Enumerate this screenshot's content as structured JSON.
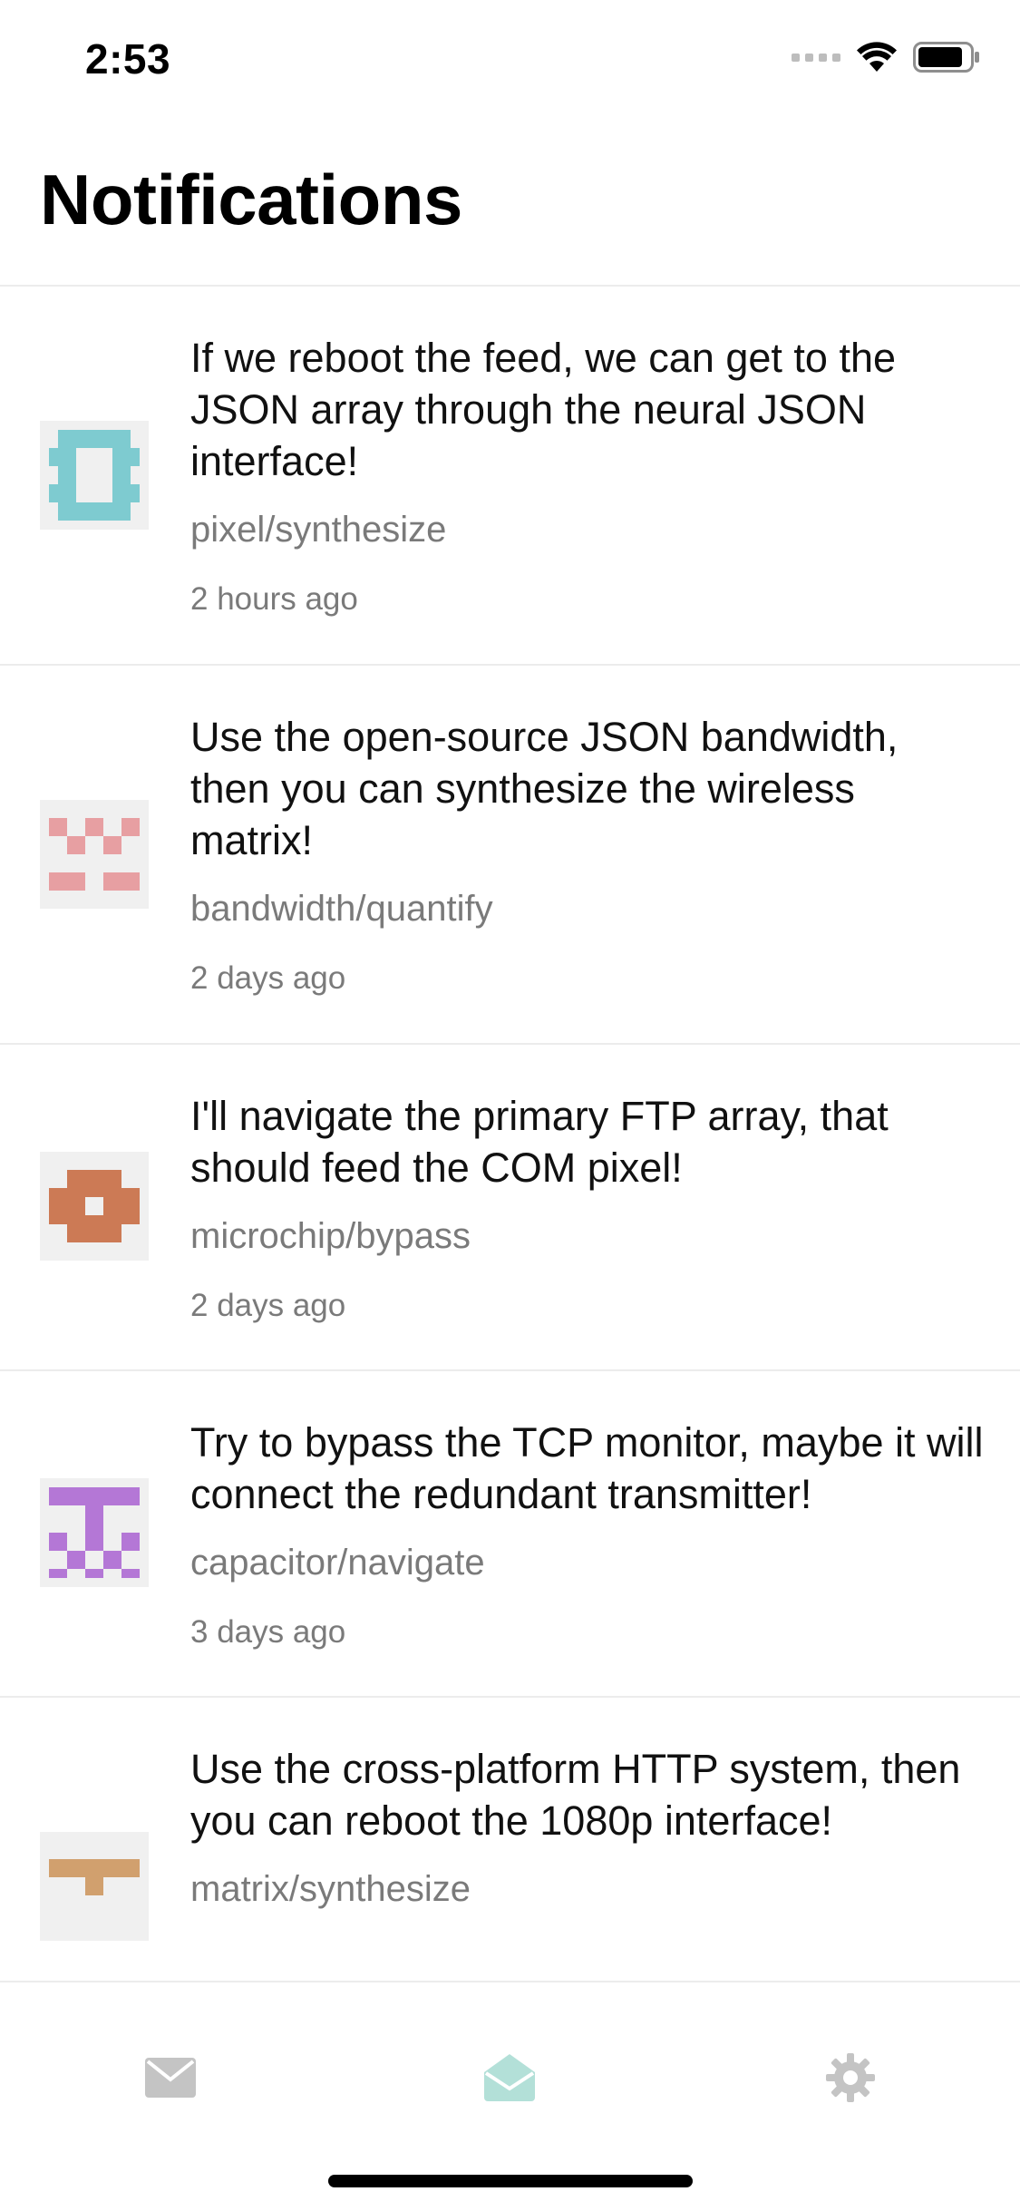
{
  "status_bar": {
    "time": "2:53"
  },
  "page": {
    "title": "Notifications"
  },
  "notifications": [
    {
      "message": "If we reboot the feed, we can get to the JSON array through the neural JSON interface!",
      "path": "pixel/synthesize",
      "time": "2 hours ago",
      "avatar_color": "#7ecbd0"
    },
    {
      "message": "Use the open-source JSON bandwidth, then you can synthesize the wireless matrix!",
      "path": "bandwidth/quantify",
      "time": "2 days ago",
      "avatar_color": "#e79fa2"
    },
    {
      "message": "I'll navigate the primary FTP array, that should feed the COM pixel!",
      "path": "microchip/bypass",
      "time": "2 days ago",
      "avatar_color": "#cc7a55"
    },
    {
      "message": "Try to bypass the TCP monitor, maybe it will connect the redundant transmitter!",
      "path": "capacitor/navigate",
      "time": "3 days ago",
      "avatar_color": "#b477d6"
    },
    {
      "message": "Use the cross-platform HTTP system, then you can reboot the 1080p interface!",
      "path": "matrix/synthesize",
      "time": "",
      "avatar_color": "#d1a06e"
    }
  ],
  "tab_bar": {
    "tabs": [
      {
        "icon": "mail-icon",
        "active": false,
        "color": "#c4c4c4"
      },
      {
        "icon": "open-mail-icon",
        "active": true,
        "color": "#b3e0d8"
      },
      {
        "icon": "gear-icon",
        "active": false,
        "color": "#c4c4c4"
      }
    ]
  }
}
